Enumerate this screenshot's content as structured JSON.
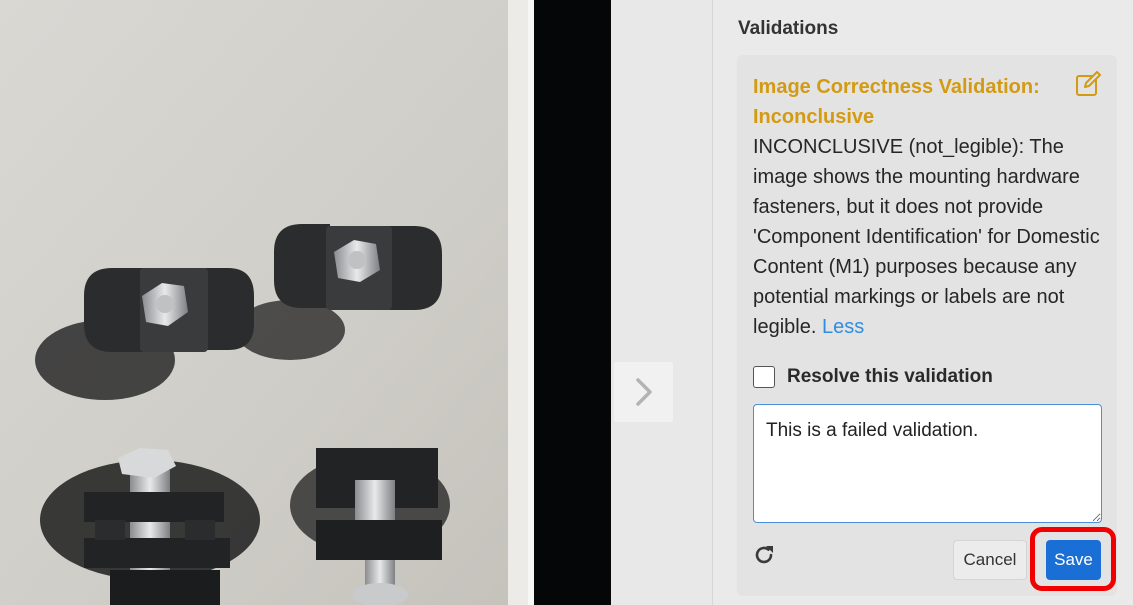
{
  "panel": {
    "title": "Validations"
  },
  "validation": {
    "heading": "Image Correctness Validation: Inconclusive",
    "description": "INCONCLUSIVE (not_legible): The image shows the mounting hardware fasteners, but it does not provide 'Component Identification' for Domestic Content (M1) purposes because any potential markings or labels are not legible.",
    "less_link": "Less",
    "heading_color": "#d39a12"
  },
  "resolve": {
    "label": "Resolve this validation",
    "checked": false
  },
  "comment": {
    "value": "This is a failed validation."
  },
  "actions": {
    "cancel_label": "Cancel",
    "save_label": "Save",
    "save_color": "#1a6fd6",
    "highlight_color": "#f00000"
  },
  "icons": {
    "edit": "edit-icon",
    "refresh": "refresh-icon",
    "next": "chevron-right-icon"
  }
}
